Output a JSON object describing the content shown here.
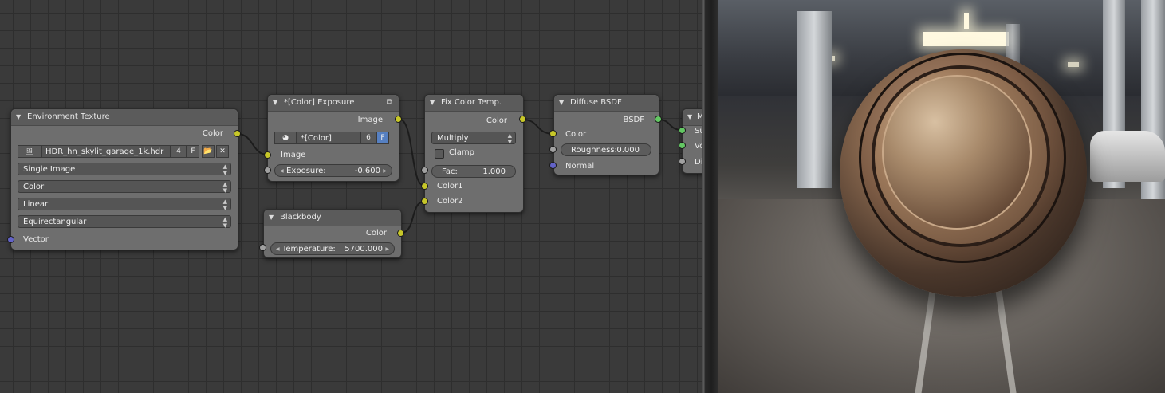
{
  "node_editor": {
    "environment_texture": {
      "title": "Environment Texture",
      "output_color": "Color",
      "image_name": "HDR_hn_skylit_garage_1k.hdr",
      "users": "4",
      "fake": "F",
      "projection_source": "Single Image",
      "color_space": "Color",
      "interpolation": "Linear",
      "projection": "Equirectangular",
      "input_vector": "Vector"
    },
    "exposure": {
      "title": "*[Color] Exposure",
      "output_image": "Image",
      "group_name": "*[Color] Expo...",
      "users": "6",
      "fake": "F",
      "input_image": "Image",
      "exposure_label": "Exposure:",
      "exposure_value": "-0.600"
    },
    "blackbody": {
      "title": "Blackbody",
      "output_color": "Color",
      "temperature_label": "Temperature:",
      "temperature_value": "5700.000"
    },
    "fix_color_temp": {
      "title": "Fix Color Temp.",
      "output_color": "Color",
      "blend_mode": "Multiply",
      "clamp_label": "Clamp",
      "fac_label": "Fac:",
      "fac_value": "1.000",
      "input_color1": "Color1",
      "input_color2": "Color2"
    },
    "diffuse_bsdf": {
      "title": "Diffuse BSDF",
      "output_bsdf": "BSDF",
      "input_color": "Color",
      "roughness_label": "Roughness:",
      "roughness_value": "0.000",
      "input_normal": "Normal"
    },
    "mix_shader_partial": {
      "title": "M",
      "input_1": "Su",
      "input_2": "Vo",
      "input_3": "Di"
    }
  },
  "colors": {
    "socket_color": "#c7c729",
    "socket_shader": "#63c763",
    "socket_vector": "#6363c7",
    "socket_value": "#a1a1a1",
    "node_body": "#6e6e6e",
    "node_header": "#5b5b5b",
    "grid_background": "#3a3a3a"
  }
}
